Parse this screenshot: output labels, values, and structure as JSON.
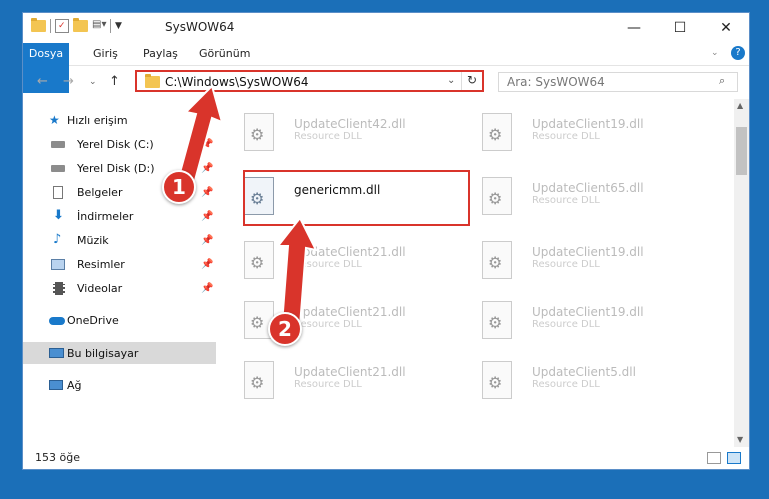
{
  "window": {
    "title": "SysWOW64",
    "controls": {
      "minimize": "—",
      "maximize": "☐",
      "close": "✕"
    }
  },
  "ribbon": {
    "tabs": [
      "Dosya",
      "Giriş",
      "Paylaş",
      "Görünüm"
    ]
  },
  "address": {
    "path": "C:\\Windows\\SysWOW64",
    "search_placeholder": "Ara: SysWOW64"
  },
  "sidebar": {
    "items": [
      {
        "label": "Hızlı erişim",
        "icon": "star-icon"
      },
      {
        "label": "Yerel Disk (C:)",
        "icon": "drive-icon",
        "pinned": true
      },
      {
        "label": "Yerel Disk (D:)",
        "icon": "drive-icon",
        "pinned": true
      },
      {
        "label": "Belgeler",
        "icon": "documents-icon",
        "pinned": true
      },
      {
        "label": "İndirmeler",
        "icon": "download-icon",
        "pinned": true
      },
      {
        "label": "Müzik",
        "icon": "music-icon",
        "pinned": true
      },
      {
        "label": "Resimler",
        "icon": "pictures-icon",
        "pinned": true
      },
      {
        "label": "Videolar",
        "icon": "video-icon",
        "pinned": true
      },
      {
        "label": "OneDrive",
        "icon": "cloud-icon"
      },
      {
        "label": "Bu bilgisayar",
        "icon": "computer-icon",
        "selected": true
      },
      {
        "label": "Ağ",
        "icon": "network-icon"
      }
    ]
  },
  "files": [
    {
      "name": "UpdateClient42.dll",
      "type": "Resource DLL"
    },
    {
      "name": "UpdateClient19.dll",
      "type": "Resource DLL"
    },
    {
      "name": "genericmm.dll",
      "type": "",
      "active": true
    },
    {
      "name": "UpdateClient65.dll",
      "type": "Resource DLL"
    },
    {
      "name": "UpdateClient21.dll",
      "type": "Resource DLL"
    },
    {
      "name": "UpdateClient19.dll",
      "type": "Resource DLL"
    },
    {
      "name": "UpdateClient21.dll",
      "type": "Resource DLL"
    },
    {
      "name": "UpdateClient19.dll",
      "type": "Resource DLL"
    },
    {
      "name": "UpdateClient21.dll",
      "type": "Resource DLL"
    },
    {
      "name": "UpdateClient5.dll",
      "type": "Resource DLL"
    }
  ],
  "status": {
    "count": "153 öğe"
  },
  "callouts": [
    "1",
    "2"
  ],
  "colors": {
    "accent": "#1979ca",
    "highlight": "#d9342b",
    "desktop": "#1b6fb8"
  }
}
